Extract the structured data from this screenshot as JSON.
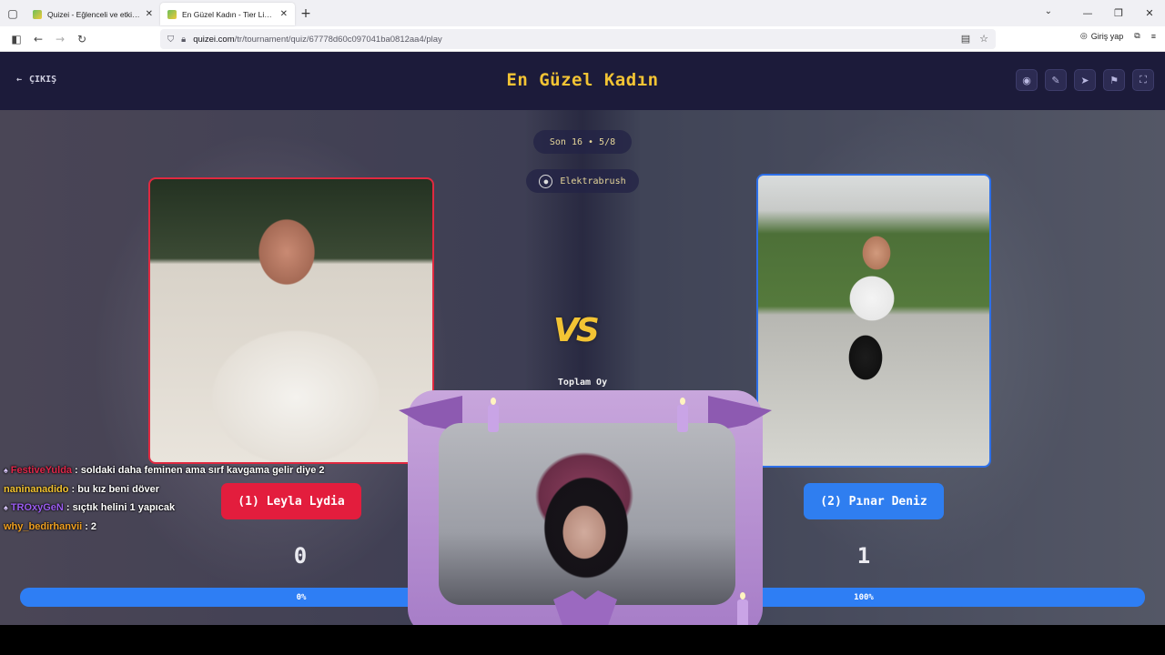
{
  "browser": {
    "tabs": [
      {
        "title": "Quizei - Eğlenceli ve etkileşimli",
        "active": false
      },
      {
        "title": "En Güzel Kadın - Tier List, Kör S",
        "active": true
      }
    ],
    "new_tab": "+",
    "url_prefix": "quizei.com",
    "url_path": "/tr/tournament/quiz/67778d60c097041ba0812aa4/play",
    "login_label": "Giriş yap"
  },
  "header": {
    "exit_label": "ÇIKIŞ",
    "title": "En Güzel Kadın",
    "icons": [
      "eye-icon",
      "edit-icon",
      "send-icon",
      "flag-icon",
      "fullscreen-icon"
    ]
  },
  "match": {
    "round_label": "Son 16 • 5/8",
    "author": "Elektrabrush",
    "vs_label": "VS",
    "total_votes_label": "Toplam Oy",
    "left": {
      "name": "(1) Leyla Lydia",
      "score": "0",
      "percent": "0%",
      "percent_value": 0,
      "color": "#e31d3d"
    },
    "right": {
      "name": "(2) Pınar Deniz",
      "score": "1",
      "percent": "100%",
      "percent_value": 100,
      "color": "#2f7ef0"
    }
  },
  "chat": [
    {
      "user": "FestiveYulda",
      "user_color": "#e0274a",
      "message": ": soldaki daha feminen ama sırf kavgama gelir diye 2",
      "badge": true
    },
    {
      "user": "naninanadido",
      "user_color": "#f2c230",
      "message": ": bu kız beni döver",
      "badge": false
    },
    {
      "user": "TROxyGeN",
      "user_color": "#9b5cf0",
      "message": ": sıçtık helini 1 yapıcak",
      "badge": true
    },
    {
      "user": "why_bedirhanvii",
      "user_color": "#f0a020",
      "message": ": 2",
      "badge": false
    }
  ]
}
